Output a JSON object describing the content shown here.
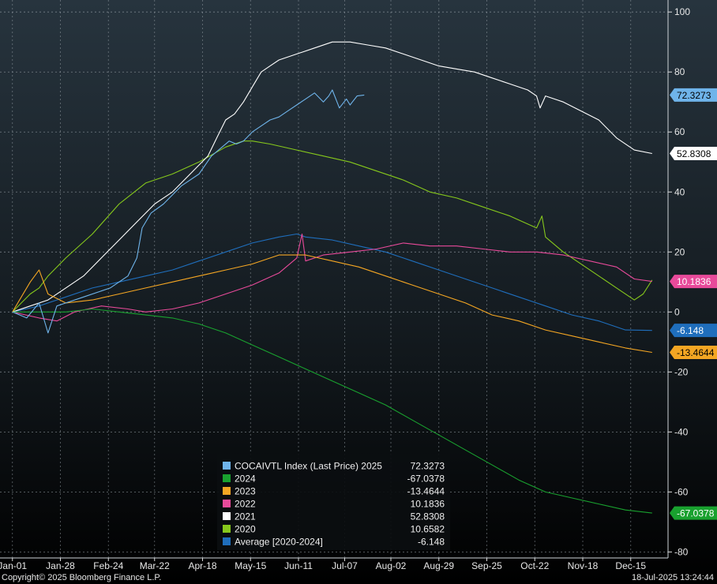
{
  "footer": {
    "copyright": "Copyright© 2025 Bloomberg Finance L.P.",
    "timestamp": "18-Jul-2025 13:24:44"
  },
  "chart_data": {
    "type": "line",
    "ylim": [
      -82,
      104
    ],
    "yticks": [
      100,
      80,
      60,
      40,
      20,
      0,
      -20,
      -40,
      -60,
      -80
    ],
    "xticks": [
      {
        "label": "Jan-01",
        "day": 0
      },
      {
        "label": "Jan-28",
        "day": 27
      },
      {
        "label": "Feb-24",
        "day": 54
      },
      {
        "label": "Mar-22",
        "day": 80
      },
      {
        "label": "Apr-18",
        "day": 107
      },
      {
        "label": "May-15",
        "day": 134
      },
      {
        "label": "Jun-11",
        "day": 161
      },
      {
        "label": "Jul-07",
        "day": 187
      },
      {
        "label": "Aug-02",
        "day": 213
      },
      {
        "label": "Aug-29",
        "day": 240
      },
      {
        "label": "Sep-25",
        "day": 267
      },
      {
        "label": "Oct-22",
        "day": 294
      },
      {
        "label": "Nov-18",
        "day": 321
      },
      {
        "label": "Dec-15",
        "day": 348
      }
    ],
    "xlim": [
      -7,
      369
    ],
    "grid": true,
    "legend_position": "bottom-center",
    "series": [
      {
        "name": "COCAIVTL Index (Last Price) 2025",
        "legend_value": "72.3273",
        "color": "#6fb4ea",
        "x": [
          0,
          8,
          15,
          20,
          25,
          30,
          40,
          55,
          65,
          70,
          73,
          78,
          85,
          95,
          105,
          112,
          118,
          122,
          126,
          130,
          135,
          140,
          145,
          150,
          155,
          160,
          165,
          170,
          175,
          178,
          180,
          184,
          188,
          190,
          194,
          198
        ],
        "y": [
          0,
          -2,
          3,
          -7,
          2,
          3,
          5,
          8,
          12,
          18,
          28,
          33,
          36,
          42,
          46,
          52,
          55,
          57,
          56,
          57,
          60,
          62,
          64,
          65,
          67,
          69,
          71,
          73,
          70,
          72,
          74,
          68,
          71,
          69,
          72,
          72.3273
        ]
      },
      {
        "name": "2024",
        "legend_value": "-67.0378",
        "color": "#19a12f",
        "x": [
          0,
          15,
          30,
          45,
          60,
          75,
          90,
          105,
          120,
          135,
          150,
          165,
          180,
          195,
          210,
          225,
          240,
          255,
          270,
          285,
          300,
          315,
          330,
          345,
          360
        ],
        "y": [
          0,
          0,
          0,
          1,
          0,
          -1,
          -2,
          -4,
          -7,
          -11,
          -15,
          -19,
          -23,
          -27,
          -31,
          -36,
          -41,
          -46,
          -51,
          -56,
          -60,
          -62,
          -64,
          -66,
          -67.0378
        ]
      },
      {
        "name": "2023",
        "legend_value": "-13.4644",
        "color": "#f4a623",
        "x": [
          0,
          5,
          10,
          15,
          20,
          30,
          45,
          60,
          75,
          90,
          105,
          120,
          135,
          150,
          165,
          180,
          195,
          210,
          225,
          240,
          255,
          270,
          285,
          300,
          315,
          330,
          345,
          360
        ],
        "y": [
          0,
          5,
          10,
          14,
          6,
          3,
          4,
          6,
          8,
          10,
          12,
          14,
          16,
          19,
          19,
          17,
          15,
          12,
          9,
          6,
          3,
          -1,
          -3,
          -6,
          -8,
          -10,
          -12,
          -13.4644
        ]
      },
      {
        "name": "2022",
        "legend_value": "10.1836",
        "color": "#e84a9a",
        "x": [
          0,
          15,
          25,
          35,
          50,
          65,
          75,
          90,
          105,
          120,
          135,
          150,
          160,
          163,
          165,
          175,
          190,
          205,
          220,
          235,
          250,
          265,
          280,
          295,
          310,
          325,
          340,
          350,
          360
        ],
        "y": [
          0,
          -2,
          -3,
          0,
          2,
          1,
          0,
          1,
          3,
          6,
          9,
          13,
          18,
          26,
          17,
          19,
          20,
          21,
          23,
          22,
          22,
          21,
          20,
          20,
          19,
          17,
          15,
          11,
          10.1836
        ]
      },
      {
        "name": "2021",
        "legend_value": "52.8308",
        "color": "#ffffff",
        "x": [
          0,
          10,
          20,
          30,
          40,
          50,
          60,
          70,
          80,
          90,
          100,
          110,
          115,
          120,
          125,
          130,
          135,
          140,
          145,
          150,
          160,
          170,
          180,
          190,
          200,
          210,
          220,
          230,
          240,
          250,
          260,
          270,
          280,
          290,
          295,
          297,
          300,
          310,
          320,
          330,
          340,
          350,
          360
        ],
        "y": [
          0,
          2,
          4,
          8,
          12,
          18,
          24,
          30,
          36,
          40,
          46,
          52,
          58,
          64,
          66,
          70,
          75,
          80,
          82,
          84,
          86,
          88,
          90,
          90,
          89,
          88,
          86,
          84,
          82,
          81,
          80,
          78,
          76,
          74,
          72,
          68,
          72,
          70,
          67,
          64,
          58,
          54,
          52.8308
        ]
      },
      {
        "name": "2020",
        "legend_value": "10.6582",
        "color": "#86c81c",
        "x": [
          0,
          5,
          10,
          15,
          20,
          30,
          45,
          60,
          75,
          90,
          105,
          120,
          130,
          135,
          145,
          160,
          175,
          190,
          205,
          220,
          235,
          250,
          265,
          280,
          295,
          298,
          300,
          310,
          325,
          340,
          350,
          355,
          360
        ],
        "y": [
          0,
          3,
          6,
          8,
          12,
          18,
          26,
          36,
          43,
          46,
          50,
          55,
          57,
          57,
          56,
          54,
          52,
          50,
          47,
          44,
          40,
          38,
          35,
          32,
          28,
          32,
          25,
          20,
          14,
          8,
          4,
          6,
          10.6582
        ]
      },
      {
        "name": "Average  [2020-2024]",
        "legend_value": "-6.148",
        "color": "#1f6ebc",
        "x": [
          0,
          15,
          30,
          45,
          60,
          75,
          90,
          105,
          120,
          135,
          150,
          160,
          165,
          180,
          195,
          210,
          225,
          240,
          255,
          270,
          285,
          300,
          315,
          330,
          345,
          360
        ],
        "y": [
          0,
          2,
          5,
          8,
          10,
          12,
          14,
          17,
          20,
          23,
          25,
          26,
          25,
          24,
          22,
          20,
          17,
          14,
          11,
          8,
          5,
          2,
          -1,
          -3,
          -6,
          -6.148
        ]
      }
    ],
    "right_labels": [
      {
        "text": "72.3273",
        "y": 72.3273,
        "bg": "#6fb4ea",
        "fg": "#000000"
      },
      {
        "text": "52.8308",
        "y": 52.8308,
        "bg": "#ffffff",
        "fg": "#000000"
      },
      {
        "text": "10.1836",
        "y": 10.1836,
        "bg": "#e84a9a",
        "fg": "#ffffff"
      },
      {
        "text": "-6.148",
        "y": -6.148,
        "bg": "#1f6ebc",
        "fg": "#ffffff"
      },
      {
        "text": "-13.4644",
        "y": -13.4644,
        "bg": "#f4a623",
        "fg": "#000000"
      },
      {
        "text": "-67.0378",
        "y": -67.0378,
        "bg": "#19a12f",
        "fg": "#ffffff"
      }
    ]
  }
}
